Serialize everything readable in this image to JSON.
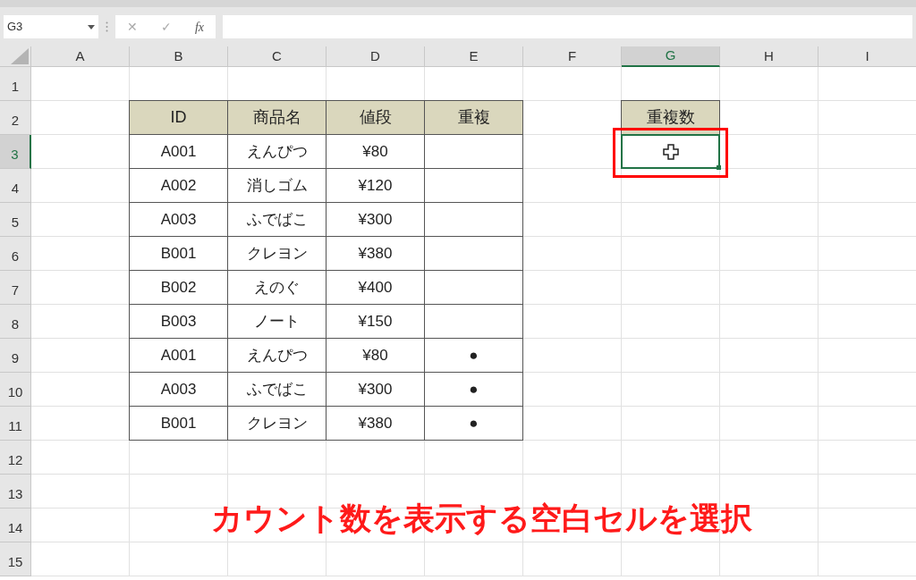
{
  "name_box": {
    "value": "G3"
  },
  "formula_bar": {
    "cancel": "✕",
    "enter": "✓",
    "function": "fx"
  },
  "columns": [
    {
      "label": "A",
      "selected": false
    },
    {
      "label": "B",
      "selected": false
    },
    {
      "label": "C",
      "selected": false
    },
    {
      "label": "D",
      "selected": false
    },
    {
      "label": "E",
      "selected": false
    },
    {
      "label": "F",
      "selected": false
    },
    {
      "label": "G",
      "selected": true
    },
    {
      "label": "H",
      "selected": false
    },
    {
      "label": "I",
      "selected": false
    }
  ],
  "rows": [
    {
      "label": "1",
      "selected": false
    },
    {
      "label": "2",
      "selected": false
    },
    {
      "label": "3",
      "selected": true
    },
    {
      "label": "4",
      "selected": false
    },
    {
      "label": "5",
      "selected": false
    },
    {
      "label": "6",
      "selected": false
    },
    {
      "label": "7",
      "selected": false
    },
    {
      "label": "8",
      "selected": false
    },
    {
      "label": "9",
      "selected": false
    },
    {
      "label": "10",
      "selected": false
    },
    {
      "label": "11",
      "selected": false
    },
    {
      "label": "12",
      "selected": false
    },
    {
      "label": "13",
      "selected": false
    },
    {
      "label": "14",
      "selected": false
    },
    {
      "label": "15",
      "selected": false
    }
  ],
  "table": {
    "headers": [
      "ID",
      "商品名",
      "値段",
      "重複"
    ],
    "rows": [
      {
        "id": "A001",
        "name": "えんぴつ",
        "price": "¥80"
      },
      {
        "id": "A002",
        "name": "消しゴム",
        "price": "¥120"
      },
      {
        "id": "A003",
        "name": "ふでばこ",
        "price": "¥300"
      },
      {
        "id": "B001",
        "name": "クレヨン",
        "price": "¥380"
      },
      {
        "id": "B002",
        "name": "えのぐ",
        "price": "¥400"
      },
      {
        "id": "B003",
        "name": "ノート",
        "price": "¥150"
      },
      {
        "id": "A001",
        "name": "えんぴつ",
        "price": "¥80",
        "duplicate": "●"
      },
      {
        "id": "A003",
        "name": "ふでばこ",
        "price": "¥300",
        "duplicate": "●"
      },
      {
        "id": "B001",
        "name": "クレヨン",
        "price": "¥380",
        "duplicate": "●"
      }
    ]
  },
  "count": {
    "header": "重複数",
    "selected": true
  },
  "caption": "カウント数を表示する空白セルを選択"
}
